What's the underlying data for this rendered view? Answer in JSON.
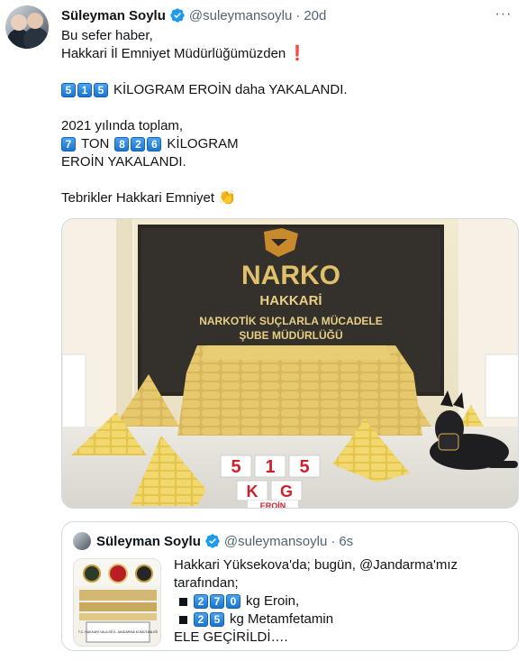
{
  "tweet": {
    "author_name": "Süleyman Soylu",
    "author_handle": "@suleymansoylu",
    "separator": "·",
    "time": "20d",
    "more": "···",
    "line1": "Bu sefer haber,",
    "line2": "Hakkari İl Emniyet Müdürlüğümüzden",
    "line2_emoji": "❗",
    "line3_digits": [
      "5",
      "1",
      "5"
    ],
    "line3_text": "KİLOGRAM EROİN daha YAKALANDI.",
    "line4": "2021 yılında toplam,",
    "line5_digit1": "7",
    "line5_mid": "TON",
    "line5_digits": [
      "8",
      "2",
      "6"
    ],
    "line5_text": "KİLOGRAM",
    "line6": "EROİN YAKALANDI.",
    "line7": "Tebrikler Hakkari Emniyet",
    "line7_emoji": "👏"
  },
  "photo": {
    "logo_text": "NARKO",
    "city": "HAKKARİ",
    "sign_line1": "NARKOTİK SUÇLARLA MÜCADELE",
    "sign_line2": "ŞUBE MÜDÜRLÜĞÜ",
    "amount_digits": [
      "5",
      "1",
      "5"
    ],
    "unit": [
      "K",
      "G"
    ],
    "drug_label": "EROİN"
  },
  "quote": {
    "author_name": "Süleyman Soylu",
    "author_handle": "@suleymansoylu",
    "separator": "·",
    "time": "6s",
    "line1": "Hakkari Yüksekova'da; bugün, @Jandarma'mız",
    "line2": "tarafından;",
    "item1_digits": [
      "2",
      "7",
      "0"
    ],
    "item1_text": "kg Eroin,",
    "item2_digits": [
      "2",
      "5"
    ],
    "item2_text": "kg Metamfetamin",
    "line5": "ELE GEÇİRİLDİ….",
    "thumb_label": "T.C. HAKKARİ VALİLİĞİ İL JANDARMA KOMUTANLIĞI"
  },
  "colors": {
    "text": "#0f1419",
    "secondary": "#536471",
    "verified": "#1d9bf0",
    "border": "#cfd9de",
    "keycap": "#1a75d2"
  },
  "icons": [
    "verified-badge-icon",
    "more-icon",
    "exclamation-icon",
    "clap-icon"
  ]
}
